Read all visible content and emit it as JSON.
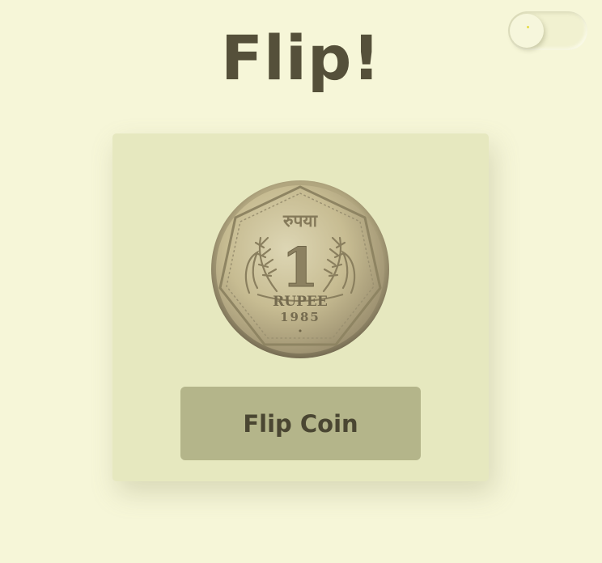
{
  "header": {
    "title": "Flip!"
  },
  "theme_toggle": {
    "state": "off"
  },
  "coin": {
    "top_text": "रुपया",
    "denomination": "1",
    "unit": "RUPEE",
    "year": "1985",
    "mint_mark": "•"
  },
  "actions": {
    "flip_label": "Flip Coin"
  },
  "colors": {
    "background": "#f6f6d8",
    "card": "#e6e8bf",
    "button": "#b4b58a",
    "title": "#55503a",
    "button_text": "#4a4632",
    "coin_metal": "#cfc49c"
  },
  "icons": {
    "toggle": "theme-toggle-switch",
    "coin_wheat": "wheat-ear-icon"
  }
}
